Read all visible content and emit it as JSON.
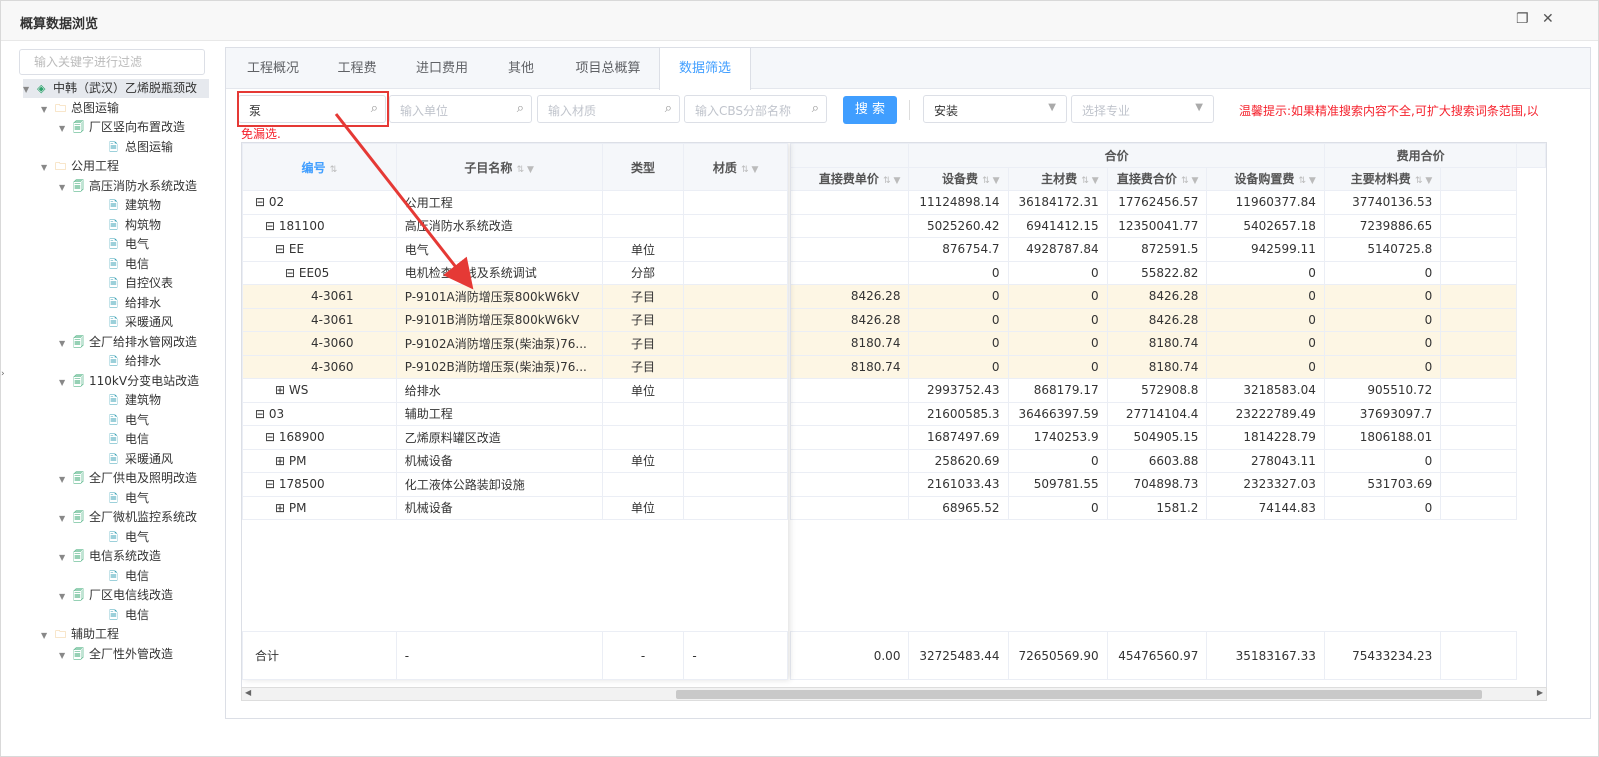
{
  "window": {
    "title": "概算数据浏览"
  },
  "tree": {
    "filter_placeholder": "输入关键字进行过滤",
    "nodes": [
      {
        "label": "中韩（武汉）乙烯脱瓶颈改",
        "icon": "cube"
      },
      {
        "label": "总图运输",
        "icon": "dir"
      },
      {
        "label": "厂区竖向布置改造",
        "icon": "doc2"
      },
      {
        "label": "总图运输",
        "icon": "doc"
      },
      {
        "label": "公用工程",
        "icon": "dir"
      },
      {
        "label": "高压消防水系统改造",
        "icon": "doc2"
      },
      {
        "label": "建筑物",
        "icon": "doc"
      },
      {
        "label": "构筑物",
        "icon": "doc"
      },
      {
        "label": "电气",
        "icon": "doc"
      },
      {
        "label": "电信",
        "icon": "doc"
      },
      {
        "label": "自控仪表",
        "icon": "doc"
      },
      {
        "label": "给排水",
        "icon": "doc"
      },
      {
        "label": "采暖通风",
        "icon": "doc"
      },
      {
        "label": "全厂给排水管网改造",
        "icon": "doc2"
      },
      {
        "label": "给排水",
        "icon": "doc"
      },
      {
        "label": "110kV分变电站改造",
        "icon": "doc2"
      },
      {
        "label": "建筑物",
        "icon": "doc"
      },
      {
        "label": "电气",
        "icon": "doc"
      },
      {
        "label": "电信",
        "icon": "doc"
      },
      {
        "label": "采暖通风",
        "icon": "doc"
      },
      {
        "label": "全厂供电及照明改造",
        "icon": "doc2"
      },
      {
        "label": "电气",
        "icon": "doc"
      },
      {
        "label": "全厂微机监控系统改",
        "icon": "doc2"
      },
      {
        "label": "电气",
        "icon": "doc"
      },
      {
        "label": "电信系统改造",
        "icon": "doc2"
      },
      {
        "label": "电信",
        "icon": "doc"
      },
      {
        "label": "厂区电信线改造",
        "icon": "doc2"
      },
      {
        "label": "电信",
        "icon": "doc"
      },
      {
        "label": "辅助工程",
        "icon": "dir"
      },
      {
        "label": "全厂性外管改造",
        "icon": "doc2"
      }
    ]
  },
  "tabs": [
    "工程概况",
    "工程费",
    "进口费用",
    "其他",
    "项目总概算",
    "数据筛选"
  ],
  "active_tab": "数据筛选",
  "search": {
    "keyword_value": "泵",
    "unit_placeholder": "输入单位",
    "material_placeholder": "输入材质",
    "cbs_placeholder": "输入CBS分部名称",
    "button_label": "搜 索",
    "type_select_value": "安装",
    "specialty_placeholder": "选择专业",
    "hint_line1": "温馨提示:如果精准搜索内容不全,可扩大搜索词条范围,以",
    "hint_line2": "免漏选."
  },
  "table": {
    "headers": {
      "code": "编号",
      "name": "子目名称",
      "type": "类型",
      "material": "材质",
      "group_hejia": "合价",
      "group_feiyong": "费用合价",
      "direct_unit": "直接费单价",
      "equip": "设备费",
      "main_mat": "主材费",
      "direct_total": "直接费合价",
      "equip_purchase": "设备购置费",
      "main_mat_fee": "主要材料费"
    },
    "rows": [
      {
        "code": "⊟ 02",
        "name": "公用工程",
        "type": "",
        "material": "",
        "direct_unit": "",
        "equip": "11124898.14",
        "main_mat": "36184172.31",
        "direct_total": "17762456.57",
        "equip_purchase": "11960377.84",
        "main_mat_fee": "37740136.53",
        "hl": false
      },
      {
        "code": "⊟ 181100",
        "name": "高压消防水系统改造",
        "type": "",
        "material": "",
        "direct_unit": "",
        "equip": "5025260.42",
        "main_mat": "6941412.15",
        "direct_total": "12350041.77",
        "equip_purchase": "5402657.18",
        "main_mat_fee": "7239886.65",
        "hl": false
      },
      {
        "code": "⊟ EE",
        "name": "电气",
        "type": "单位",
        "material": "",
        "direct_unit": "",
        "equip": "876754.7",
        "main_mat": "4928787.84",
        "direct_total": "872591.5",
        "equip_purchase": "942599.11",
        "main_mat_fee": "5140725.8",
        "hl": false
      },
      {
        "code": "⊟ EE05",
        "name": "电机检查接线及系统调试",
        "type": "分部",
        "material": "",
        "direct_unit": "",
        "equip": "0",
        "main_mat": "0",
        "direct_total": "55822.82",
        "equip_purchase": "0",
        "main_mat_fee": "0",
        "hl": false
      },
      {
        "code": "4-3061",
        "name": "P-9101A消防增压泵800kW6kV",
        "type": "子目",
        "material": "",
        "direct_unit": "8426.28",
        "equip": "0",
        "main_mat": "0",
        "direct_total": "8426.28",
        "equip_purchase": "0",
        "main_mat_fee": "0",
        "hl": true
      },
      {
        "code": "4-3061",
        "name": "P-9101B消防增压泵800kW6kV",
        "type": "子目",
        "material": "",
        "direct_unit": "8426.28",
        "equip": "0",
        "main_mat": "0",
        "direct_total": "8426.28",
        "equip_purchase": "0",
        "main_mat_fee": "0",
        "hl": true
      },
      {
        "code": "4-3060",
        "name": "P-9102A消防增压泵(柴油泵)76...",
        "type": "子目",
        "material": "",
        "direct_unit": "8180.74",
        "equip": "0",
        "main_mat": "0",
        "direct_total": "8180.74",
        "equip_purchase": "0",
        "main_mat_fee": "0",
        "hl": true
      },
      {
        "code": "4-3060",
        "name": "P-9102B消防增压泵(柴油泵)76...",
        "type": "子目",
        "material": "",
        "direct_unit": "8180.74",
        "equip": "0",
        "main_mat": "0",
        "direct_total": "8180.74",
        "equip_purchase": "0",
        "main_mat_fee": "0",
        "hl": true
      },
      {
        "code": "⊞ WS",
        "name": "给排水",
        "type": "单位",
        "material": "",
        "direct_unit": "",
        "equip": "2993752.43",
        "main_mat": "868179.17",
        "direct_total": "572908.8",
        "equip_purchase": "3218583.04",
        "main_mat_fee": "905510.72",
        "hl": false
      },
      {
        "code": "⊟ 03",
        "name": "辅助工程",
        "type": "",
        "material": "",
        "direct_unit": "",
        "equip": "21600585.3",
        "main_mat": "36466397.59",
        "direct_total": "27714104.4",
        "equip_purchase": "23222789.49",
        "main_mat_fee": "37693097.7",
        "hl": false
      },
      {
        "code": "⊟ 168900",
        "name": "乙烯原料罐区改造",
        "type": "",
        "material": "",
        "direct_unit": "",
        "equip": "1687497.69",
        "main_mat": "1740253.9",
        "direct_total": "504905.15",
        "equip_purchase": "1814228.79",
        "main_mat_fee": "1806188.01",
        "hl": false
      },
      {
        "code": "⊞ PM",
        "name": "机械设备",
        "type": "单位",
        "material": "",
        "direct_unit": "",
        "equip": "258620.69",
        "main_mat": "0",
        "direct_total": "6603.88",
        "equip_purchase": "278043.11",
        "main_mat_fee": "0",
        "hl": false
      },
      {
        "code": "⊟ 178500",
        "name": "化工液体公路装卸设施",
        "type": "",
        "material": "",
        "direct_unit": "",
        "equip": "2161033.43",
        "main_mat": "509781.55",
        "direct_total": "704898.73",
        "equip_purchase": "2323327.03",
        "main_mat_fee": "531703.69",
        "hl": false
      },
      {
        "code": "⊞ PM",
        "name": "机械设备",
        "type": "单位",
        "material": "",
        "direct_unit": "",
        "equip": "68965.52",
        "main_mat": "0",
        "direct_total": "1581.2",
        "equip_purchase": "74144.83",
        "main_mat_fee": "0",
        "hl": false
      }
    ],
    "summary": {
      "label": "合计",
      "name": "-",
      "type": "-",
      "material": "-",
      "direct_unit": "0.00",
      "equip": "32725483.44",
      "main_mat": "72650569.90",
      "direct_total": "45476560.97",
      "equip_purchase": "35183167.33",
      "main_mat_fee": "75433234.23"
    }
  },
  "annotation": {
    "color": "#e53935"
  }
}
